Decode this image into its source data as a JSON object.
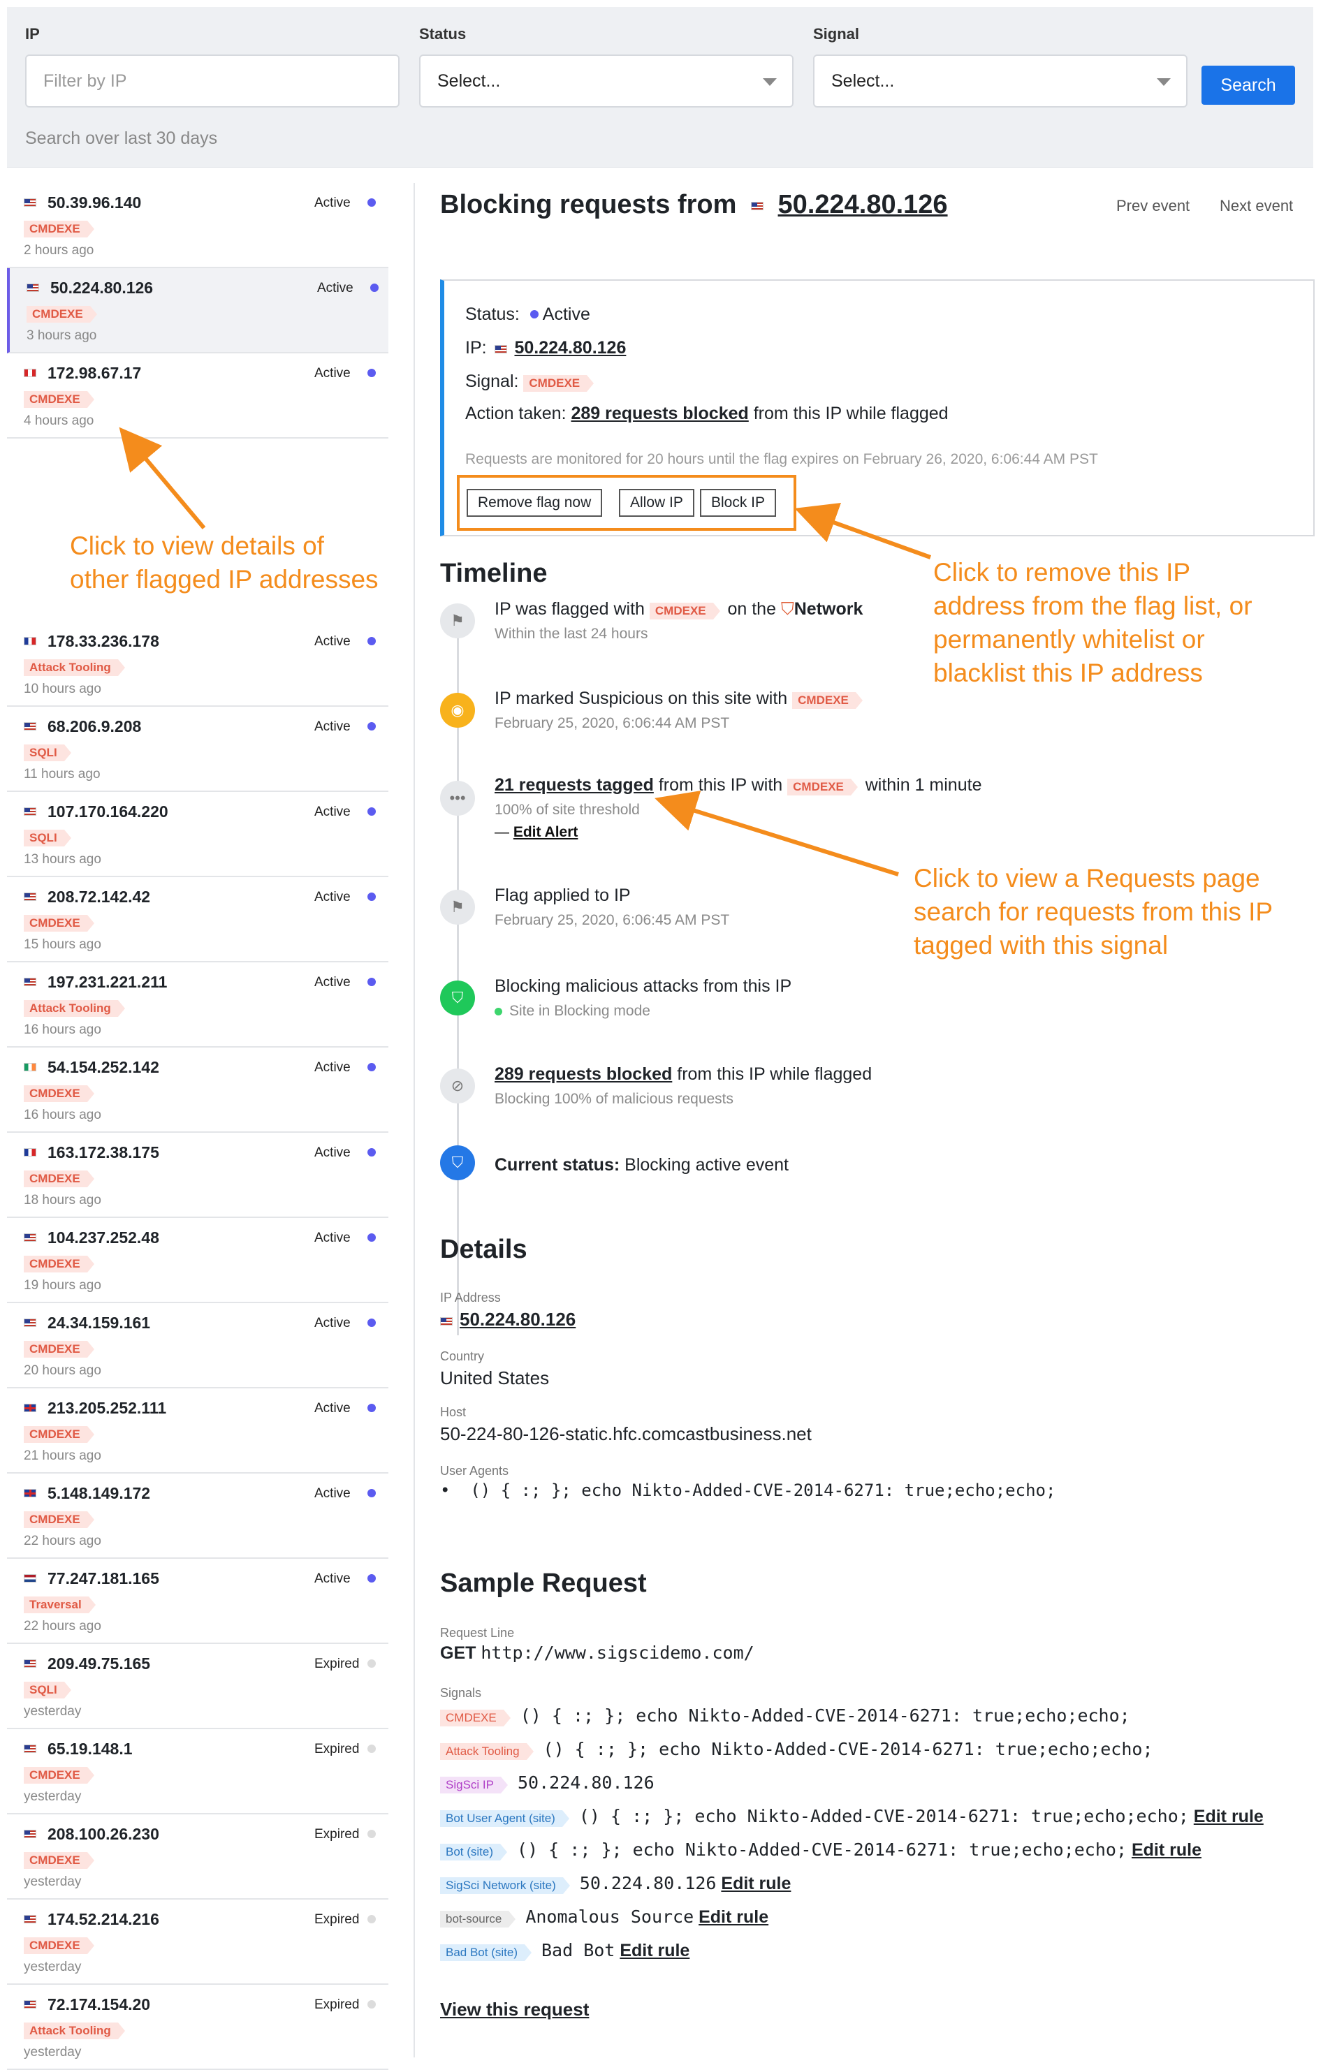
{
  "filters": {
    "ip_label": "IP",
    "ip_placeholder": "Filter by IP",
    "status_label": "Status",
    "status_value": "Select...",
    "signal_label": "Signal",
    "signal_value": "Select...",
    "search_button": "Search",
    "range_note": "Search over last 30 days"
  },
  "sidebar_items": [
    {
      "flag": "us",
      "ip": "50.39.96.140",
      "status": "Active",
      "tag": "CMDEXE",
      "time": "2 hours ago"
    },
    {
      "flag": "us",
      "ip": "50.224.80.126",
      "status": "Active",
      "tag": "CMDEXE",
      "time": "3 hours ago",
      "selected": true
    },
    {
      "flag": "ca",
      "ip": "172.98.67.17",
      "status": "Active",
      "tag": "CMDEXE",
      "time": "4 hours ago"
    },
    {
      "flag": "fr",
      "ip": "178.33.236.178",
      "status": "Active",
      "tag": "Attack Tooling",
      "time": "10 hours ago"
    },
    {
      "flag": "us",
      "ip": "68.206.9.208",
      "status": "Active",
      "tag": "SQLI",
      "time": "11 hours ago"
    },
    {
      "flag": "us",
      "ip": "107.170.164.220",
      "status": "Active",
      "tag": "SQLI",
      "time": "13 hours ago"
    },
    {
      "flag": "us",
      "ip": "208.72.142.42",
      "status": "Active",
      "tag": "CMDEXE",
      "time": "15 hours ago"
    },
    {
      "flag": "us",
      "ip": "197.231.221.211",
      "status": "Active",
      "tag": "Attack Tooling",
      "time": "16 hours ago"
    },
    {
      "flag": "ie",
      "ip": "54.154.252.142",
      "status": "Active",
      "tag": "CMDEXE",
      "time": "16 hours ago"
    },
    {
      "flag": "fr",
      "ip": "163.172.38.175",
      "status": "Active",
      "tag": "CMDEXE",
      "time": "18 hours ago"
    },
    {
      "flag": "us",
      "ip": "104.237.252.48",
      "status": "Active",
      "tag": "CMDEXE",
      "time": "19 hours ago"
    },
    {
      "flag": "us",
      "ip": "24.34.159.161",
      "status": "Active",
      "tag": "CMDEXE",
      "time": "20 hours ago"
    },
    {
      "flag": "gb",
      "ip": "213.205.252.111",
      "status": "Active",
      "tag": "CMDEXE",
      "time": "21 hours ago"
    },
    {
      "flag": "gb",
      "ip": "5.148.149.172",
      "status": "Active",
      "tag": "CMDEXE",
      "time": "22 hours ago"
    },
    {
      "flag": "nl",
      "ip": "77.247.181.165",
      "status": "Active",
      "tag": "Traversal",
      "time": "22 hours ago"
    },
    {
      "flag": "us",
      "ip": "209.49.75.165",
      "status": "Expired",
      "tag": "SQLI",
      "time": "yesterday"
    },
    {
      "flag": "us",
      "ip": "65.19.148.1",
      "status": "Expired",
      "tag": "CMDEXE",
      "time": "yesterday"
    },
    {
      "flag": "us",
      "ip": "208.100.26.230",
      "status": "Expired",
      "tag": "CMDEXE",
      "time": "yesterday"
    },
    {
      "flag": "us",
      "ip": "174.52.214.216",
      "status": "Expired",
      "tag": "CMDEXE",
      "time": "yesterday"
    },
    {
      "flag": "us",
      "ip": "72.174.154.20",
      "status": "Expired",
      "tag": "Attack Tooling",
      "time": "yesterday"
    }
  ],
  "annotations": {
    "left_note_1": "Click to view details of",
    "left_note_2": "other flagged IP addresses",
    "right_note_1": "Click to remove this IP",
    "right_note_2": "address from the flag list, or",
    "right_note_3": "permanently whitelist or",
    "right_note_4": "blacklist this IP address",
    "mid_note_1": "Click to view a Requests page",
    "mid_note_2": "search for requests from this IP",
    "mid_note_3": "tagged with this signal"
  },
  "header": {
    "title_prefix": "Blocking requests from",
    "ip": "50.224.80.126",
    "prev": "Prev event",
    "next": "Next event"
  },
  "flag_box": {
    "status_label": "Status:",
    "status_value": "Active",
    "ip_label": "IP:",
    "ip_value": "50.224.80.126",
    "signal_label": "Signal:",
    "signal_value": "CMDEXE",
    "action_label": "Action taken:",
    "action_link": "289 requests blocked",
    "action_suffix": "from this IP while flagged",
    "monitor_note": "Requests are monitored for 20 hours until the flag expires on February 26, 2020, 6:06:44 AM PST",
    "btn_remove": "Remove flag now",
    "btn_allow": "Allow IP",
    "btn_block": "Block IP"
  },
  "timeline": {
    "title": "Timeline",
    "e1_text": "IP was flagged with",
    "e1_tag": "CMDEXE",
    "e1_on": "on the",
    "e1_network": "Network",
    "e1_sub": "Within the last 24 hours",
    "e2_text": "IP marked Suspicious on this site with",
    "e2_tag": "CMDEXE",
    "e2_sub": "February 25, 2020, 6:06:44 AM PST",
    "e3_link": "21 requests tagged",
    "e3_text": "from this IP with",
    "e3_tag": "CMDEXE",
    "e3_suffix": "within 1 minute",
    "e3_sub": "100% of site threshold",
    "e3_dash": "—",
    "e3_edit": "Edit Alert",
    "e4_text": "Flag applied to IP",
    "e4_sub": "February 25, 2020, 6:06:45 AM PST",
    "e5_text": "Blocking malicious attacks from this IP",
    "e5_sub": "Site in Blocking mode",
    "e6_link": "289 requests blocked",
    "e6_text": "from this IP while flagged",
    "e6_sub": "Blocking 100% of malicious requests",
    "e7_label": "Current status:",
    "e7_value": "Blocking active event"
  },
  "details": {
    "title": "Details",
    "ip_label": "IP Address",
    "ip_value": "50.224.80.126",
    "country_label": "Country",
    "country_value": "United States",
    "host_label": "Host",
    "host_value": "50-224-80-126-static.hfc.comcastbusiness.net",
    "ua_label": "User Agents",
    "ua_value": "() { :; }; echo Nikto-Added-CVE-2014-6271: true;echo;echo;"
  },
  "sample": {
    "title": "Sample Request",
    "line_label": "Request Line",
    "method": "GET",
    "url": "http://www.sigscidemo.com/",
    "signals_label": "Signals",
    "signals": [
      {
        "tag": "CMDEXE",
        "style": "red",
        "value": "() { :; }; echo Nikto-Added-CVE-2014-6271: true;echo;echo;",
        "edit": ""
      },
      {
        "tag": "Attack Tooling",
        "style": "red",
        "value": "() { :; }; echo Nikto-Added-CVE-2014-6271: true;echo;echo;",
        "edit": ""
      },
      {
        "tag": "SigSci IP",
        "style": "purple",
        "value": "50.224.80.126",
        "edit": ""
      },
      {
        "tag": "Bot User Agent (site)",
        "style": "blue",
        "value": "() { :; }; echo Nikto-Added-CVE-2014-6271: true;echo;echo;",
        "edit": "Edit rule"
      },
      {
        "tag": "Bot (site)",
        "style": "blue",
        "value": "() { :; }; echo Nikto-Added-CVE-2014-6271: true;echo;echo;",
        "edit": "Edit rule"
      },
      {
        "tag": "SigSci Network (site)",
        "style": "blue",
        "value": "50.224.80.126",
        "edit": "Edit rule"
      },
      {
        "tag": "bot-source",
        "style": "grey",
        "value": "Anomalous Source",
        "edit": "Edit rule"
      },
      {
        "tag": "Bad Bot (site)",
        "style": "blue",
        "value": "Bad Bot",
        "edit": "Edit rule"
      }
    ],
    "view_link": "View this request"
  },
  "colors": {
    "accent": "#1a73e8",
    "annotation": "#f48c1c",
    "active_dot": "#5b5bf0",
    "tag_red": "#e05a45"
  }
}
